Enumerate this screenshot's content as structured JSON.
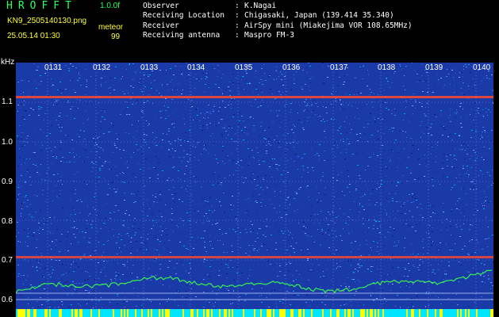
{
  "header": {
    "app_title": "HROFFT",
    "app_version": "1.0.0f",
    "file_name": "KN9_2505140130.png",
    "file_date": "25.05.14 01:30",
    "mode_label": "meteor",
    "count_value": "99"
  },
  "info": [
    {
      "key": "Observer",
      "value": "K.Nagai"
    },
    {
      "key": "Receiving Location",
      "value": "Chigasaki, Japan (139.414 35.340)"
    },
    {
      "key": "Receiver",
      "value": "AirSpy mini (Miakejima VOR 108.65MHz)"
    },
    {
      "key": "Receiving antenna",
      "value": "Maspro FM-3"
    }
  ],
  "separator": ":",
  "axis": {
    "unit": "kHz",
    "y_labels": [
      "1.1",
      "1.0",
      "0.9",
      "0.8",
      "0.7",
      "0.6"
    ],
    "time_labels": [
      "0131",
      "0132",
      "0133",
      "0134",
      "0135",
      "0136",
      "0137",
      "0138",
      "0139",
      "0140"
    ]
  },
  "colors": {
    "background": "#1a3aa8",
    "signal_line": "#ff4a2a",
    "trace": "#39ff4a",
    "bottom_bar_a": "#ffff00",
    "bottom_bar_b": "#00e5ff",
    "gridline": "#7f8fd8"
  }
}
